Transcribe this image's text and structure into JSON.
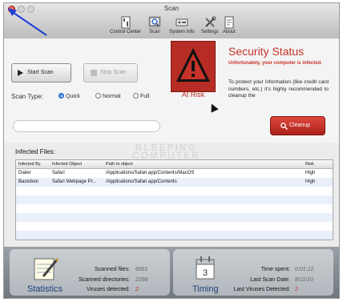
{
  "window": {
    "title": "Scan"
  },
  "toolbar": {
    "items": [
      {
        "label": "Control Center"
      },
      {
        "label": "Scan",
        "selected": true
      },
      {
        "label": "System Info"
      },
      {
        "label": "Settings"
      },
      {
        "label": "About"
      }
    ]
  },
  "scan": {
    "start_label": "Start Scan",
    "stop_label": "Stop Scan",
    "type_label": "Scan Type:",
    "types": [
      "Quick",
      "Normal",
      "Full"
    ],
    "selected_type": "Quick"
  },
  "security": {
    "title": "Security Status",
    "warning": "Unfortunately, your computer is infected.",
    "text": "To protect your information (like credit card numbers, etc.) it's highly recommended to cleanup the",
    "status": "At Risk",
    "cleanup_label": "Cleanup"
  },
  "watermark": {
    "line1": "BLEEPING",
    "line2": "COMPUTER"
  },
  "infected": {
    "label": "Infected Files:",
    "columns": [
      "Infected By",
      "Infected Object",
      "Path to object",
      "Risk"
    ],
    "rows": [
      [
        "Dialer",
        "Safari",
        "/Applications/Safari.app/Contents/MacOS",
        "High"
      ],
      [
        "Backdoor",
        "Safari Webpage Pr...",
        "/Applications/Safari.app/Contents",
        "High"
      ]
    ]
  },
  "statistics": {
    "title": "Statistics",
    "scanned_files_label": "Scanned files:",
    "scanned_files": "6661",
    "scanned_dirs_label": "Scanned directories:",
    "scanned_dirs": "2268",
    "viruses_label": "Viruses detected:",
    "viruses": "2"
  },
  "timing": {
    "title": "Timing",
    "calendar_day": "3",
    "time_spent_label": "Time spent:",
    "time_spent": "0:01:12",
    "last_scan_label": "Last Scan Date:",
    "last_scan": "8/11/10",
    "last_viruses_label": "Last Viruses Detected:",
    "last_viruses": "2"
  },
  "colors": {
    "accent_red": "#c6332a",
    "title_blue": "#1d3f7a",
    "selection_blue": "#3d86e4"
  }
}
